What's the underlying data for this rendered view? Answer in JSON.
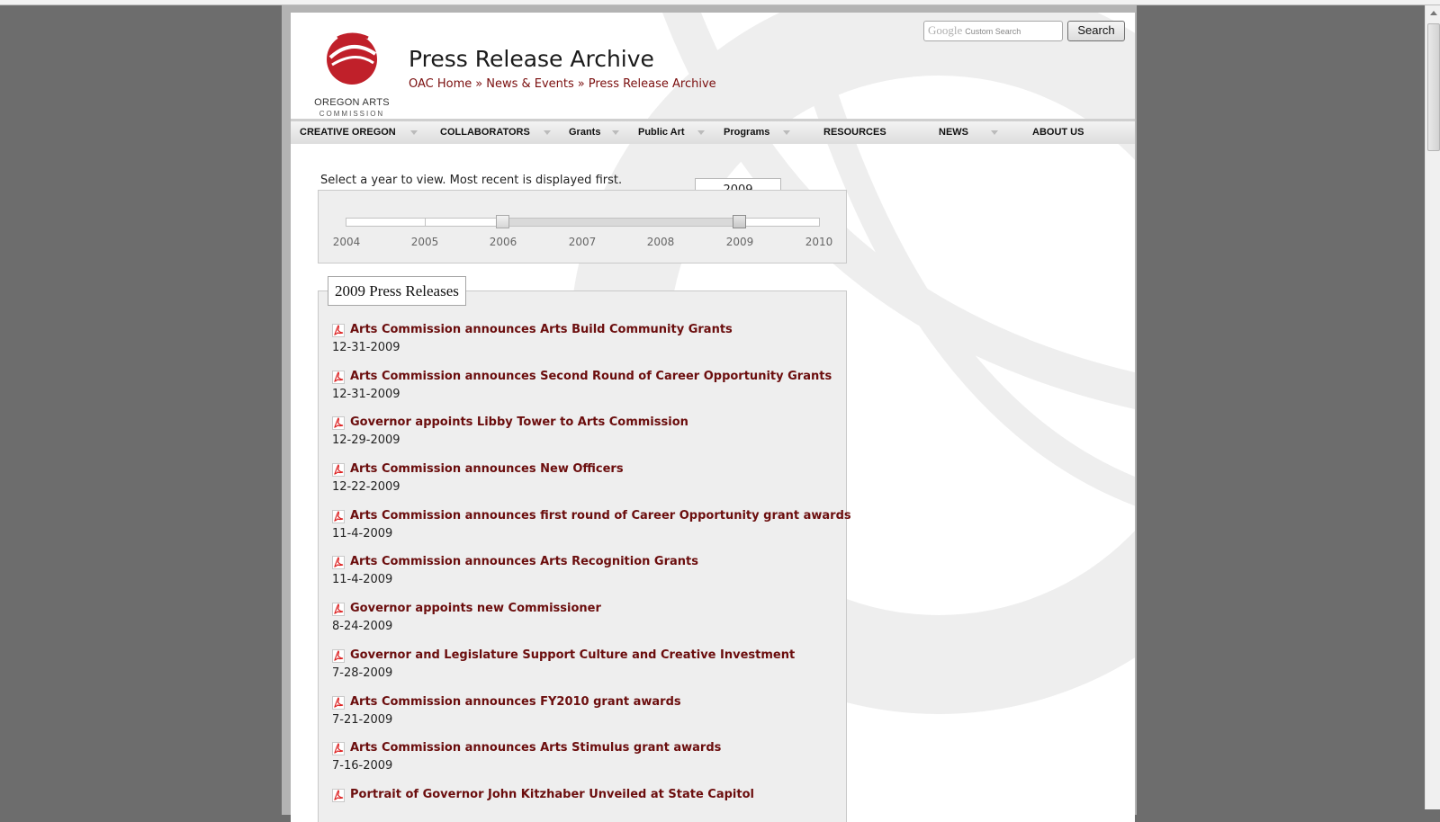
{
  "header": {
    "logo_line1": "OREGON ARTS",
    "logo_line2": "COMMISSION",
    "page_title": "Press Release Archive",
    "breadcrumb": [
      "OAC Home",
      "News & Events",
      "Press Release Archive"
    ],
    "breadcrumb_separator": "»"
  },
  "search": {
    "brand": "Google",
    "placeholder": "Custom Search",
    "button_label": "Search"
  },
  "nav": {
    "items": [
      {
        "label": "CREATIVE OREGON",
        "dropdown": true
      },
      {
        "label": "COLLABORATORS",
        "dropdown": true
      },
      {
        "label": "Grants",
        "dropdown": true
      },
      {
        "label": "Public Art",
        "dropdown": true
      },
      {
        "label": "Programs",
        "dropdown": true
      },
      {
        "label": "RESOURCES",
        "dropdown": false
      },
      {
        "label": "NEWS",
        "dropdown": true
      },
      {
        "label": "ABOUT US",
        "dropdown": false
      }
    ]
  },
  "year_selector": {
    "intro": "Select a year to view. Most recent is displayed first.",
    "years": [
      "2004",
      "2005",
      "2006",
      "2007",
      "2008",
      "2009",
      "2010"
    ],
    "selected_year": "2009",
    "range_start_year": "2006"
  },
  "releases": {
    "heading": "2009 Press Releases",
    "items": [
      {
        "title": "Arts Commission announces Arts Build Community Grants",
        "date": "12-31-2009"
      },
      {
        "title": "Arts Commission announces Second Round of Career Opportunity Grants",
        "date": "12-31-2009"
      },
      {
        "title": "Governor appoints Libby Tower to Arts Commission",
        "date": "12-29-2009"
      },
      {
        "title": "Arts Commission announces New Officers",
        "date": "12-22-2009"
      },
      {
        "title": "Arts Commission announces first round of Career Opportunity grant awards",
        "date": "11-4-2009"
      },
      {
        "title": "Arts Commission announces Arts Recognition Grants",
        "date": "11-4-2009"
      },
      {
        "title": "Governor appoints new Commissioner",
        "date": "8-24-2009"
      },
      {
        "title": "Governor and Legislature Support Culture and Creative Investment",
        "date": "7-28-2009"
      },
      {
        "title": "Arts Commission announces FY2010 grant awards",
        "date": "7-21-2009"
      },
      {
        "title": "Arts Commission announces Arts Stimulus grant awards",
        "date": "7-16-2009"
      },
      {
        "title": "Portrait of Governor John Kitzhaber Unveiled at State Capitol",
        "date": ""
      }
    ]
  },
  "colors": {
    "link": "#6b0d0d",
    "brand_red": "#c0202a",
    "background": "#6d6d6d"
  },
  "icons": {
    "release_icon": "pdf-icon",
    "logo_icon": "oac-logo-icon"
  }
}
